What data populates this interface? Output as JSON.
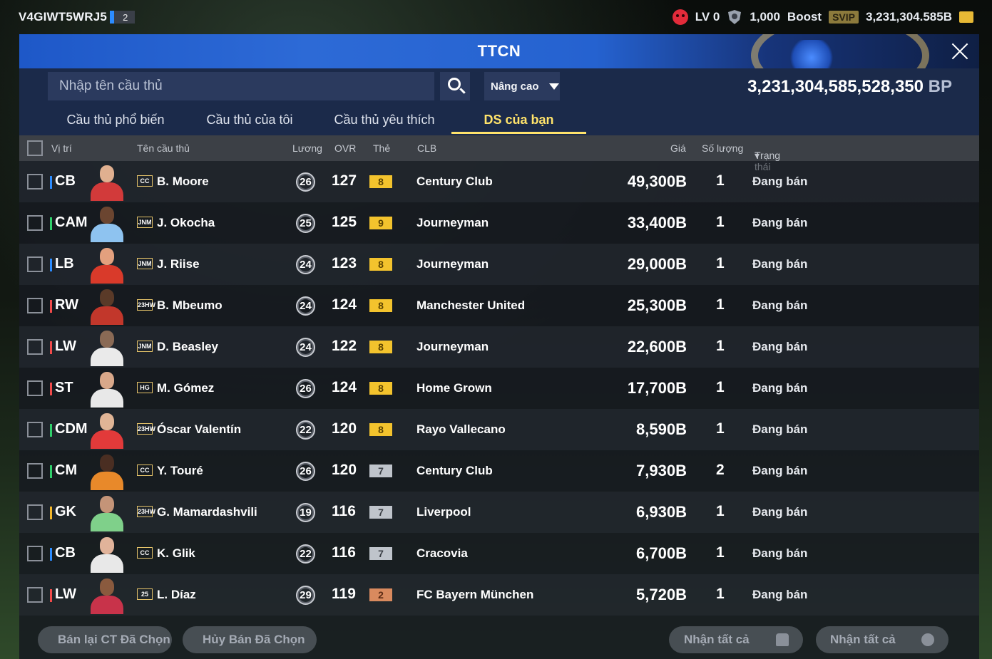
{
  "topbar": {
    "account_id": "V4GIWT5WRJ5",
    "account_badge": "2",
    "level": "LV 0",
    "points": "1,000",
    "boost_label": "Boost",
    "svip_label": "SVIP",
    "bp_balance": "3,231,304.585B"
  },
  "panel": {
    "title": "TTCN",
    "search_placeholder": "Nhập tên cầu thủ",
    "advanced_label": "Nâng cao",
    "bp_total": "3,231,304,585,528,350",
    "bp_unit": "BP"
  },
  "tabs": [
    {
      "label": "Cầu thủ phổ biến"
    },
    {
      "label": "Cầu thủ của tôi"
    },
    {
      "label": "Cầu thủ yêu thích"
    },
    {
      "label": "DS của bạn",
      "active": true
    }
  ],
  "columns": {
    "position": "Vị trí",
    "name": "Tên cầu thủ",
    "salary": "Lương",
    "ovr": "OVR",
    "card": "Thẻ",
    "club": "CLB",
    "price": "Giá",
    "quantity": "Số lượng",
    "status": "Trạng thái"
  },
  "colors": {
    "pos_defender": "#2c8cff",
    "pos_midfielder": "#2fcf6a",
    "pos_forward": "#f04a4a",
    "pos_goalkeeper": "#f2b62a",
    "grade_gold": "#f3c32d",
    "grade_silver": "#bfc4cb",
    "grade_bronze": "#d98a5e",
    "active_tab": "#ffe36b"
  },
  "rows": [
    {
      "pos": "CB",
      "role": "defender",
      "season": "CC",
      "name": "B. Moore",
      "salary": "26",
      "ovr": "127",
      "grade": "8",
      "grade_type": "gold",
      "club": "Century Club",
      "price": "49,300B",
      "qty": "1",
      "status": "Đang bán"
    },
    {
      "pos": "CAM",
      "role": "midfielder",
      "season": "JNM",
      "name": "J. Okocha",
      "salary": "25",
      "ovr": "125",
      "grade": "9",
      "grade_type": "gold",
      "club": "Journeyman",
      "price": "33,400B",
      "qty": "1",
      "status": "Đang bán"
    },
    {
      "pos": "LB",
      "role": "defender",
      "season": "JNM",
      "name": "J. Riise",
      "salary": "24",
      "ovr": "123",
      "grade": "8",
      "grade_type": "gold",
      "club": "Journeyman",
      "price": "29,000B",
      "qty": "1",
      "status": "Đang bán"
    },
    {
      "pos": "RW",
      "role": "forward",
      "season": "23HW",
      "name": "B. Mbeumo",
      "salary": "24",
      "ovr": "124",
      "grade": "8",
      "grade_type": "gold",
      "club": "Manchester United",
      "price": "25,300B",
      "qty": "1",
      "status": "Đang bán"
    },
    {
      "pos": "LW",
      "role": "forward",
      "season": "JNM",
      "name": "D. Beasley",
      "salary": "24",
      "ovr": "122",
      "grade": "8",
      "grade_type": "gold",
      "club": "Journeyman",
      "price": "22,600B",
      "qty": "1",
      "status": "Đang bán"
    },
    {
      "pos": "ST",
      "role": "forward",
      "season": "HG",
      "name": "M. Gómez",
      "salary": "26",
      "ovr": "124",
      "grade": "8",
      "grade_type": "gold",
      "club": "Home Grown",
      "price": "17,700B",
      "qty": "1",
      "status": "Đang bán"
    },
    {
      "pos": "CDM",
      "role": "midfielder",
      "season": "23HW",
      "name": "Óscar Valentín",
      "salary": "22",
      "ovr": "120",
      "grade": "8",
      "grade_type": "gold",
      "club": "Rayo Vallecano",
      "price": "8,590B",
      "qty": "1",
      "status": "Đang bán"
    },
    {
      "pos": "CM",
      "role": "midfielder",
      "season": "CC",
      "name": "Y. Touré",
      "salary": "26",
      "ovr": "120",
      "grade": "7",
      "grade_type": "silver",
      "club": "Century Club",
      "price": "7,930B",
      "qty": "2",
      "status": "Đang bán"
    },
    {
      "pos": "GK",
      "role": "goalkeeper",
      "season": "23HW",
      "name": "G. Mamardashvili",
      "salary": "19",
      "ovr": "116",
      "grade": "7",
      "grade_type": "silver",
      "club": "Liverpool",
      "price": "6,930B",
      "qty": "1",
      "status": "Đang bán"
    },
    {
      "pos": "CB",
      "role": "defender",
      "season": "CC",
      "name": "K. Glik",
      "salary": "22",
      "ovr": "116",
      "grade": "7",
      "grade_type": "silver",
      "club": "Cracovia",
      "price": "6,700B",
      "qty": "1",
      "status": "Đang bán"
    },
    {
      "pos": "LW",
      "role": "forward",
      "season": "25",
      "name": "L. Díaz",
      "salary": "29",
      "ovr": "119",
      "grade": "2",
      "grade_type": "bronze",
      "club": "FC Bayern München",
      "price": "5,720B",
      "qty": "1",
      "status": "Đang bán"
    }
  ],
  "bottom": {
    "resell_label": "Bán lại CT Đã Chọn",
    "cancel_label": "Hủy Bán Đã Chọn",
    "receive_all_items_label": "Nhận tất cả",
    "receive_all_bp_label": "Nhận tất cả"
  }
}
